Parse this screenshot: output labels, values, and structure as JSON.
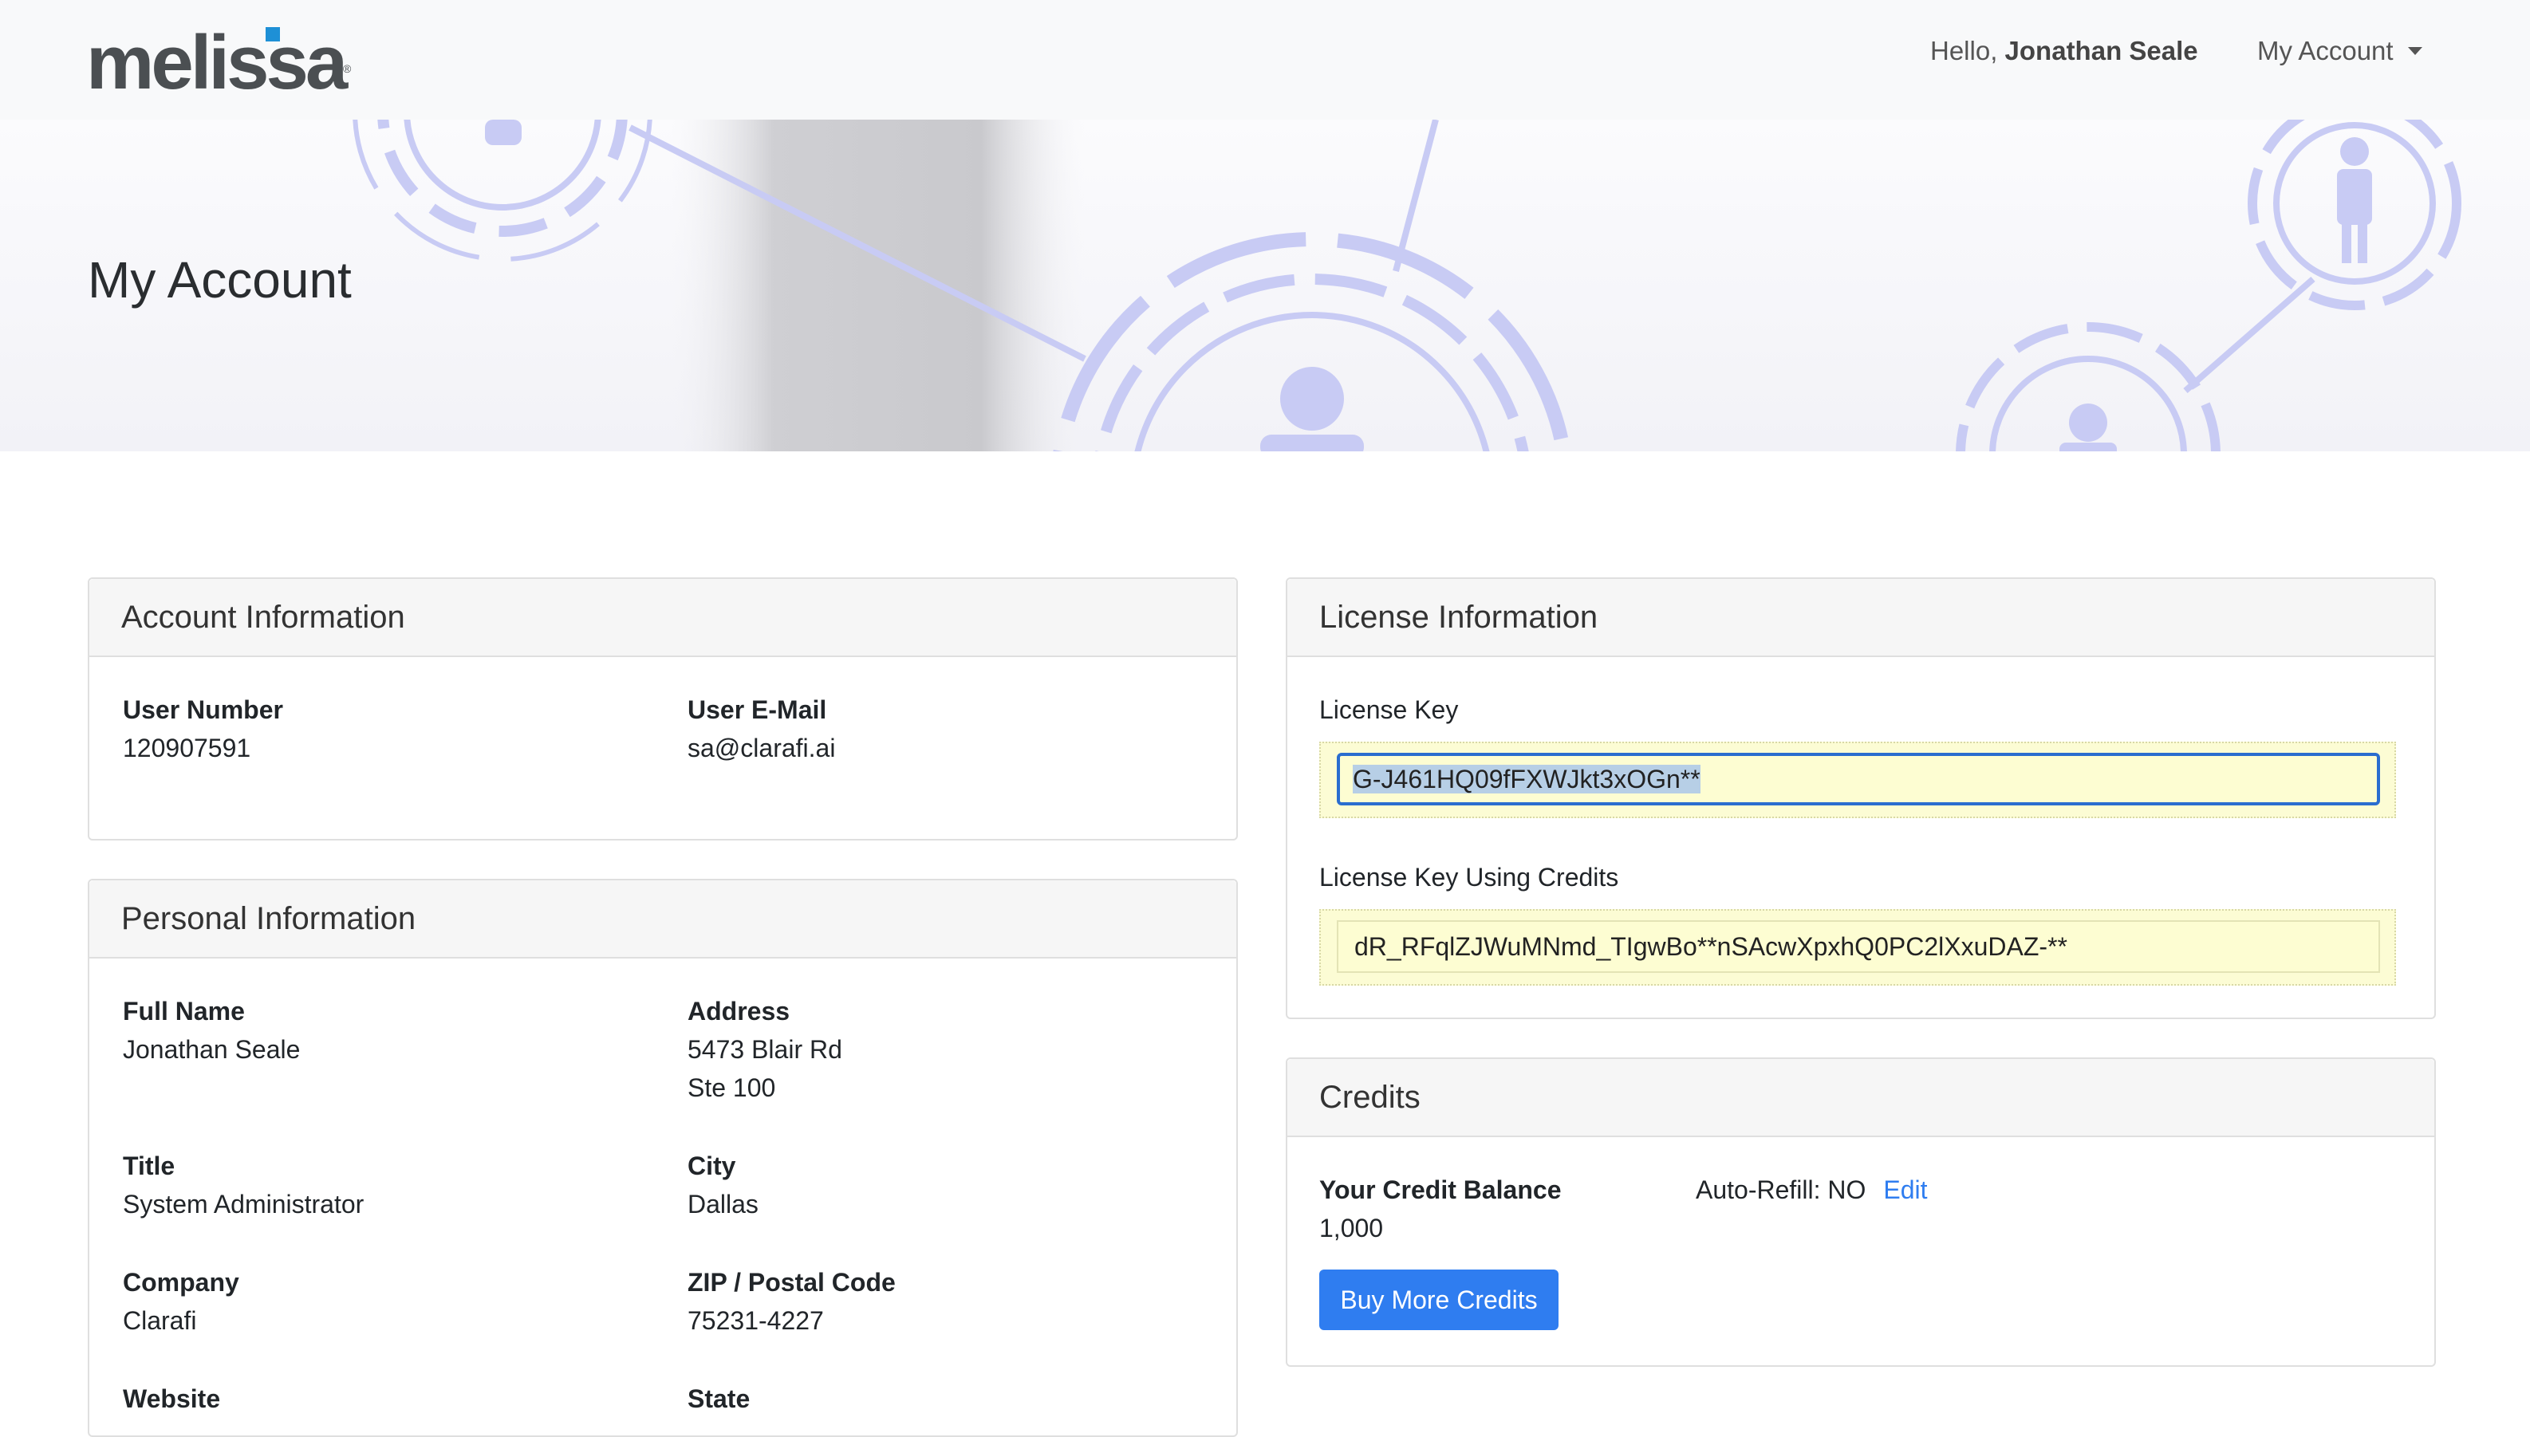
{
  "brand": {
    "logo_text": "melissa",
    "logo_mark": "®",
    "accent": "#1e90d6"
  },
  "nav": {
    "greeting": "Hello,",
    "user_name": "Jonathan Seale",
    "account_menu": "My Account"
  },
  "page": {
    "title": "My Account"
  },
  "account_info": {
    "title": "Account Information",
    "user_number_label": "User Number",
    "user_number": "120907591",
    "user_email_label": "User E-Mail",
    "user_email": "sa@clarafi.ai"
  },
  "personal_info": {
    "title": "Personal Information",
    "full_name_label": "Full Name",
    "full_name": "Jonathan Seale",
    "address_label": "Address",
    "address_line1": "5473 Blair Rd",
    "address_line2": "Ste 100",
    "title_label": "Title",
    "job_title": "System Administrator",
    "city_label": "City",
    "city": "Dallas",
    "company_label": "Company",
    "company": "Clarafi",
    "zip_label": "ZIP / Postal Code",
    "zip": "75231-4227",
    "website_label": "Website",
    "state_label": "State"
  },
  "license_info": {
    "title": "License Information",
    "license_key_label": "License Key",
    "license_key": "G-J461HQ09fFXWJkt3xOGn**",
    "credits_key_label": "License Key Using Credits",
    "credits_key": "dR_RFqlZJWuMNmd_TIgwBo**nSAcwXpxhQ0PC2lXxuDAZ-**"
  },
  "credits": {
    "title": "Credits",
    "balance_label": "Your Credit Balance",
    "balance": "1,000",
    "auto_refill": "Auto-Refill: NO",
    "edit_label": "Edit",
    "buy_button": "Buy More Credits",
    "button_color": "#2f7df0"
  }
}
